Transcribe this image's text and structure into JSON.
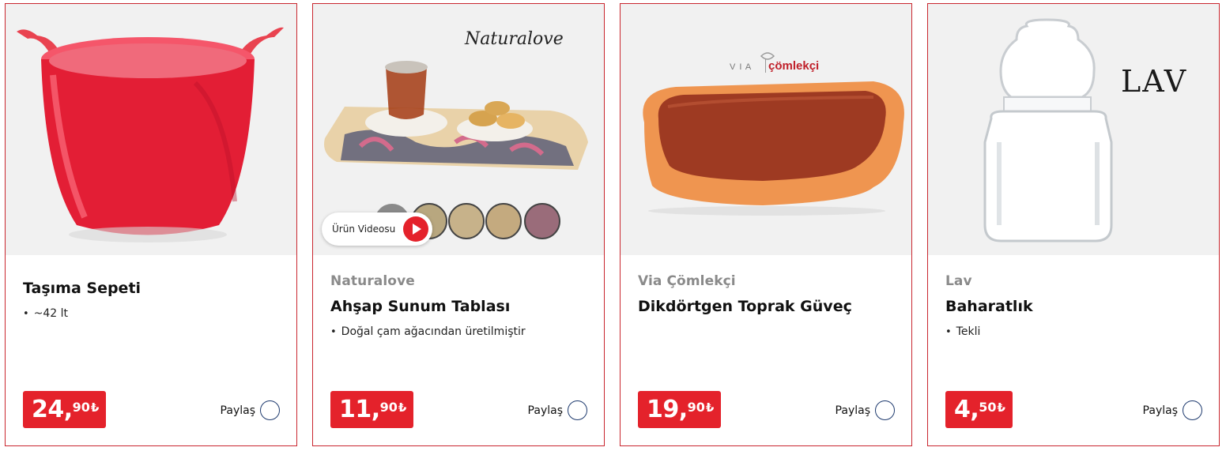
{
  "products": [
    {
      "brand": "",
      "title": "Taşıma Sepeti",
      "feature": "~42 lt",
      "price_int": "24,",
      "price_dec": "90",
      "currency": "₺",
      "share_label": "Paylaş",
      "image_icon": "red-plastic-basket-image",
      "colors": {
        "product": "#e8303e"
      }
    },
    {
      "brand": "Naturalove",
      "title": "Ahşap Sunum Tablası",
      "feature": "Doğal çam ağacından üretilmiştir",
      "price_int": "11,",
      "price_dec": "90",
      "currency": "₺",
      "share_label": "Paylaş",
      "image_icon": "wooden-serving-tray-image",
      "image_logo": "Naturalove",
      "video_label": "Ürün Videosu",
      "colors": {
        "product": "#d9b98a"
      }
    },
    {
      "brand": "Via Çömlekçi",
      "title": "Dikdörtgen Toprak Güveç",
      "feature": "",
      "price_int": "19,",
      "price_dec": "90",
      "currency": "₺",
      "share_label": "Paylaş",
      "image_icon": "clay-casserole-image",
      "image_logo_left": "V I A",
      "image_logo_right": "çömlekçi",
      "colors": {
        "product": "#e88a4c"
      }
    },
    {
      "brand": "Lav",
      "title": "Baharatlık",
      "feature": "Tekli",
      "price_int": "4,",
      "price_dec": "50",
      "currency": "₺",
      "share_label": "Paylaş",
      "image_icon": "glass-spice-jar-image",
      "image_logo": "LAV",
      "colors": {
        "product": "#e9ecee"
      }
    }
  ],
  "colors": {
    "accent": "#e4222b",
    "border": "#c9262e",
    "brand_text": "#8a8a8a",
    "share_ring": "#1e3a6e"
  }
}
